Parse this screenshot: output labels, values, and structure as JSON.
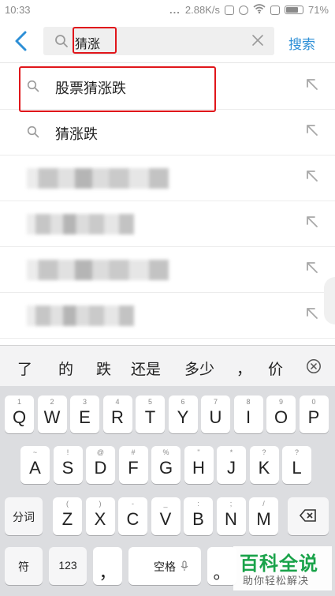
{
  "status_bar": {
    "time": "10:33",
    "dots": "...",
    "network_speed": "2.88K/s",
    "battery": "71%"
  },
  "search": {
    "back_icon": "chevron-left-icon",
    "value": "猜涨",
    "search_button": "搜索",
    "accent_color": "#2d8fd6",
    "annotation_color": "#e0161b"
  },
  "suggestions": [
    {
      "label": "股票猜涨跌",
      "blurred": false,
      "highlighted": true
    },
    {
      "label": "猜涨跌",
      "blurred": false,
      "highlighted": false
    },
    {
      "label": "",
      "blurred": true
    },
    {
      "label": "",
      "blurred": true
    },
    {
      "label": "",
      "blurred": true
    },
    {
      "label": "",
      "blurred": true
    }
  ],
  "keyboard": {
    "candidates": [
      "了",
      "的",
      "跌",
      "还是",
      "多少",
      "，",
      "价"
    ],
    "row1": [
      {
        "main": "Q",
        "sub": "1"
      },
      {
        "main": "W",
        "sub": "2"
      },
      {
        "main": "E",
        "sub": "3"
      },
      {
        "main": "R",
        "sub": "4"
      },
      {
        "main": "T",
        "sub": "5"
      },
      {
        "main": "Y",
        "sub": "6"
      },
      {
        "main": "U",
        "sub": "7"
      },
      {
        "main": "I",
        "sub": "8"
      },
      {
        "main": "O",
        "sub": "9"
      },
      {
        "main": "P",
        "sub": "0"
      }
    ],
    "row2": [
      {
        "main": "A",
        "sub": "~"
      },
      {
        "main": "S",
        "sub": "!"
      },
      {
        "main": "D",
        "sub": "@"
      },
      {
        "main": "F",
        "sub": "#"
      },
      {
        "main": "G",
        "sub": "%"
      },
      {
        "main": "H",
        "sub": "\""
      },
      {
        "main": "J",
        "sub": "*"
      },
      {
        "main": "K",
        "sub": "?"
      },
      {
        "main": "L",
        "sub": "?"
      }
    ],
    "row3": [
      {
        "main": "Z",
        "sub": "("
      },
      {
        "main": "X",
        "sub": ")"
      },
      {
        "main": "C",
        "sub": "-"
      },
      {
        "main": "V",
        "sub": "_"
      },
      {
        "main": "B",
        "sub": ":"
      },
      {
        "main": "N",
        "sub": ";"
      },
      {
        "main": "M",
        "sub": "/"
      }
    ],
    "shift_label": "分词",
    "symbols_label": "符",
    "numbers_label": "123",
    "comma_label": "，",
    "space_label": "空格",
    "period_label": "。"
  },
  "watermark": {
    "title": "百科全说",
    "subtitle": "助你轻松解决"
  }
}
